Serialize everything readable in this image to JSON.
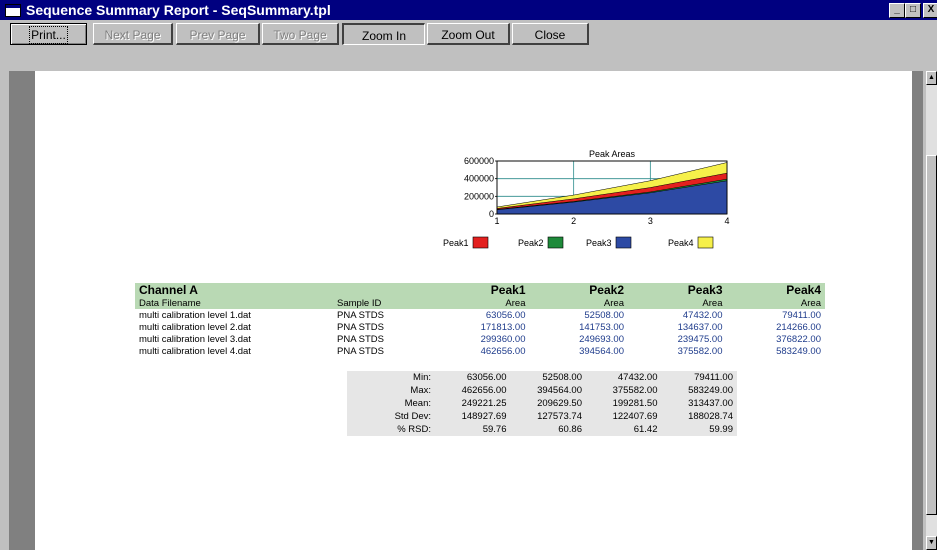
{
  "window": {
    "title": "Sequence Summary Report - SeqSummary.tpl"
  },
  "toolbar": {
    "print": "Print...",
    "next_page": "Next Page",
    "prev_page": "Prev Page",
    "two_page": "Two Page",
    "zoom_in": "Zoom In",
    "zoom_out": "Zoom Out",
    "close": "Close"
  },
  "title_buttons": {
    "minimize": "_",
    "maximize": "□",
    "close": "X"
  },
  "chart_data": {
    "type": "area",
    "title": "Peak Areas",
    "x": [
      1,
      2,
      3,
      4
    ],
    "xticks": [
      "1",
      "2",
      "3",
      "4"
    ],
    "yticks": [
      "0",
      "200000",
      "400000",
      "600000"
    ],
    "ylim": [
      0,
      600000
    ],
    "stacked": false,
    "series": [
      {
        "name": "Peak4",
        "color": "#f6f04a",
        "values": [
          79411,
          214266,
          376822,
          583249
        ]
      },
      {
        "name": "Peak1",
        "color": "#e3201f",
        "values": [
          63056,
          171813,
          299360,
          462656
        ]
      },
      {
        "name": "Peak2",
        "color": "#1e8a3a",
        "values": [
          52508,
          141753,
          249693,
          394564
        ]
      },
      {
        "name": "Peak3",
        "color": "#2d4aa4",
        "values": [
          47432,
          134637,
          239475,
          375582
        ]
      }
    ],
    "legend": [
      {
        "label": "Peak1",
        "color": "#e3201f"
      },
      {
        "label": "Peak2",
        "color": "#1e8a3a"
      },
      {
        "label": "Peak3",
        "color": "#2d4aa4"
      },
      {
        "label": "Peak4",
        "color": "#f6f04a"
      }
    ],
    "grid": true,
    "legend_position": "bottom"
  },
  "report": {
    "channel": "Channel A",
    "col_filename": "Data Filename",
    "col_sample": "Sample ID",
    "peaks": [
      "Peak1",
      "Peak2",
      "Peak3",
      "Peak4"
    ],
    "metric": "Area",
    "rows": [
      {
        "file": "multi calibration level 1.dat",
        "sample": "PNA STDS",
        "v": [
          "63056.00",
          "52508.00",
          "47432.00",
          "79411.00"
        ]
      },
      {
        "file": "multi calibration level 2.dat",
        "sample": "PNA STDS",
        "v": [
          "171813.00",
          "141753.00",
          "134637.00",
          "214266.00"
        ]
      },
      {
        "file": "multi calibration level 3.dat",
        "sample": "PNA STDS",
        "v": [
          "299360.00",
          "249693.00",
          "239475.00",
          "376822.00"
        ]
      },
      {
        "file": "multi calibration level 4.dat",
        "sample": "PNA STDS",
        "v": [
          "462656.00",
          "394564.00",
          "375582.00",
          "583249.00"
        ]
      }
    ],
    "stats": [
      {
        "label": "Min:",
        "v": [
          "63056.00",
          "52508.00",
          "47432.00",
          "79411.00"
        ]
      },
      {
        "label": "Max:",
        "v": [
          "462656.00",
          "394564.00",
          "375582.00",
          "583249.00"
        ]
      },
      {
        "label": "Mean:",
        "v": [
          "249221.25",
          "209629.50",
          "199281.50",
          "313437.00"
        ]
      },
      {
        "label": "Std Dev:",
        "v": [
          "148927.69",
          "127573.74",
          "122407.69",
          "188028.74"
        ]
      },
      {
        "label": "% RSD:",
        "v": [
          "59.76",
          "60.86",
          "61.42",
          "59.99"
        ]
      }
    ]
  }
}
